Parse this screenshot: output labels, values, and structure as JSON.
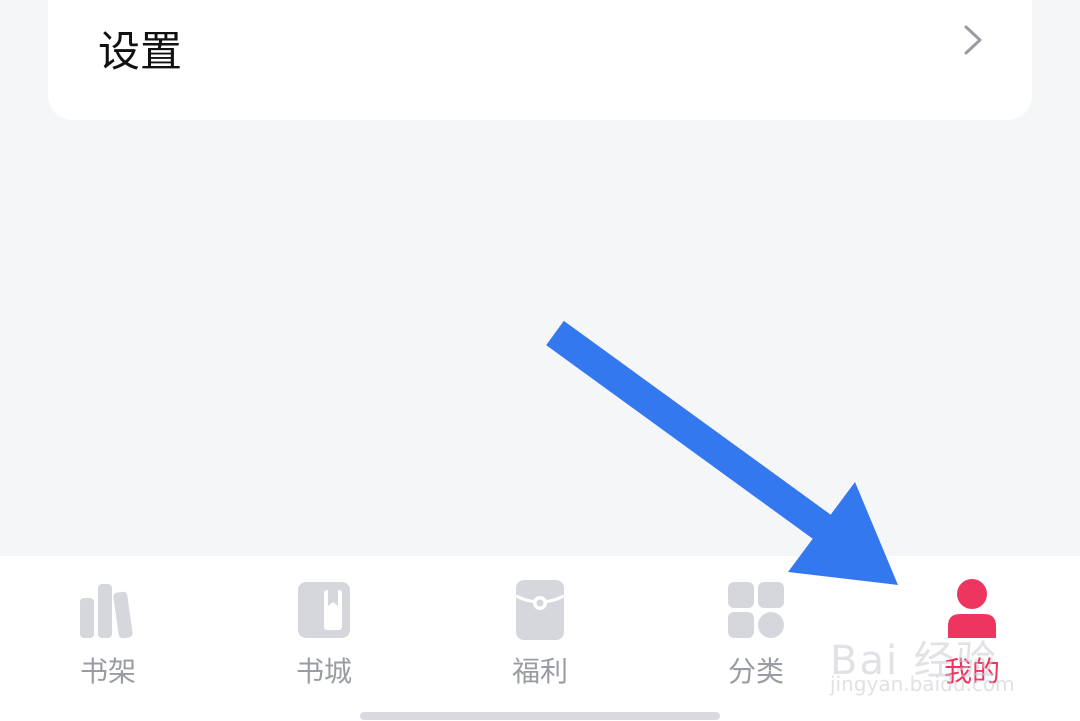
{
  "settings_row": {
    "label": "设置",
    "chevron_icon": "chevron-right-icon"
  },
  "tab_bar": {
    "tabs": [
      {
        "label": "书架",
        "icon": "bookshelf-icon",
        "active": false
      },
      {
        "label": "书城",
        "icon": "book-store-icon",
        "active": false
      },
      {
        "label": "福利",
        "icon": "welfare-icon",
        "active": false
      },
      {
        "label": "分类",
        "icon": "category-grid-icon",
        "active": false
      },
      {
        "label": "我的",
        "icon": "profile-icon",
        "active": true
      }
    ]
  },
  "colors": {
    "background": "#f5f6f8",
    "inactive_tab": "#9a9ca3",
    "inactive_icon": "#d5d7dd",
    "active_tab": "#ee3560",
    "arrow": "#3478f0"
  },
  "watermark": {
    "brand": "Bai  经验",
    "url": "jingyan.baidu.com"
  }
}
